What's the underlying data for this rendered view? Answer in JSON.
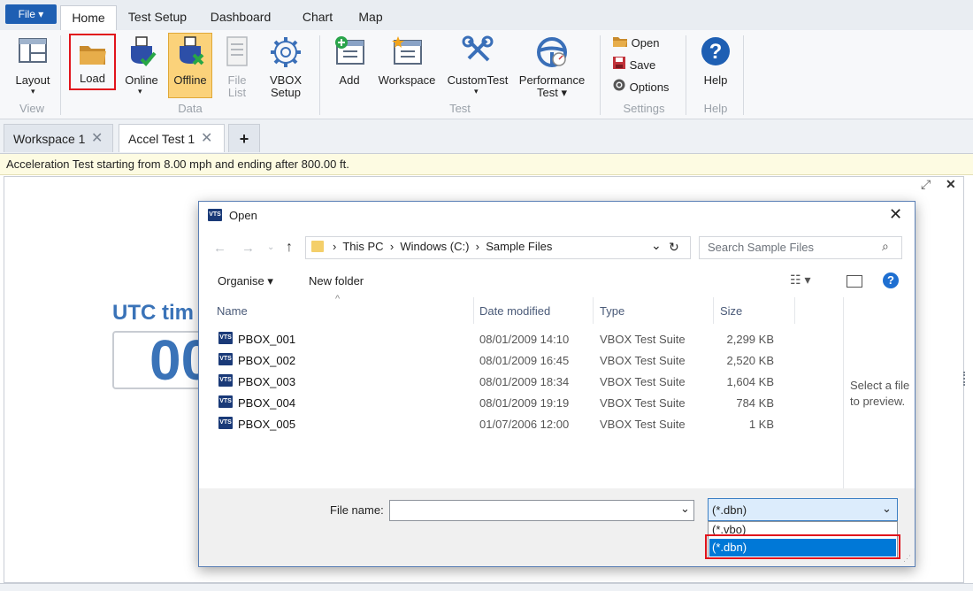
{
  "ribbon": {
    "file_label": "File ▾",
    "tabs": [
      "Home",
      "Test Setup",
      "Dashboard",
      "Chart",
      "Map"
    ],
    "buttons": {
      "layout": "Layout",
      "load": "Load",
      "online": "Online",
      "offline": "Offline",
      "file_list_1": "File",
      "file_list_2": "List",
      "vbox_setup_1": "VBOX",
      "vbox_setup_2": "Setup",
      "add": "Add",
      "workspace": "Workspace",
      "customtest": "CustomTest",
      "performance_1": "Performance",
      "performance_2": "Test ▾",
      "open": "Open",
      "save": "Save",
      "options": "Options",
      "help": "Help"
    },
    "groups": [
      "View",
      "Data",
      "Test",
      "Settings",
      "Help"
    ]
  },
  "doc_tabs": [
    "Workspace 1",
    "Accel Test 1"
  ],
  "add_tab": "+",
  "info_bar": "Acceleration Test starting from 8.00 mph and ending after 800.00 ft.",
  "background": {
    "utc_label": "UTC tim",
    "utc_value": "00"
  },
  "dialog": {
    "title": "Open",
    "breadcrumb": [
      "This PC",
      "Windows (C:)",
      "Sample Files"
    ],
    "search_placeholder": "Search Sample Files",
    "organise": "Organise ▾",
    "new_folder": "New folder",
    "columns": [
      "Name",
      "Date modified",
      "Type",
      "Size"
    ],
    "files": [
      {
        "name": "PBOX_001",
        "date": "08/01/2009 14:10",
        "type": "VBOX Test Suite",
        "size": "2,299 KB"
      },
      {
        "name": "PBOX_002",
        "date": "08/01/2009 16:45",
        "type": "VBOX Test Suite",
        "size": "2,520 KB"
      },
      {
        "name": "PBOX_003",
        "date": "08/01/2009 18:34",
        "type": "VBOX Test Suite",
        "size": "1,604 KB"
      },
      {
        "name": "PBOX_004",
        "date": "08/01/2009 19:19",
        "type": "VBOX Test Suite",
        "size": "784 KB"
      },
      {
        "name": "PBOX_005",
        "date": "01/07/2006 12:00",
        "type": "VBOX Test Suite",
        "size": "1 KB"
      }
    ],
    "preview_text_1": "Select a file",
    "preview_text_2": "to preview.",
    "file_name_label": "File name:",
    "file_name_value": "",
    "filter_selected": "(*.dbn)",
    "filter_options": [
      "(*.vbo)",
      "(*.dbn)"
    ]
  },
  "colors": {
    "accent": "#1e5fb3",
    "highlight": "#0078d7",
    "red_box": "#e1141c",
    "offline_bg": "#fbd27a"
  },
  "icons": [
    "layout-icon",
    "folder-icon",
    "usb-online-icon",
    "usb-offline-icon",
    "file-list-icon",
    "gear-icon",
    "add-window-icon",
    "workspace-icon",
    "tools-icon",
    "steering-wheel-icon",
    "help-icon"
  ]
}
